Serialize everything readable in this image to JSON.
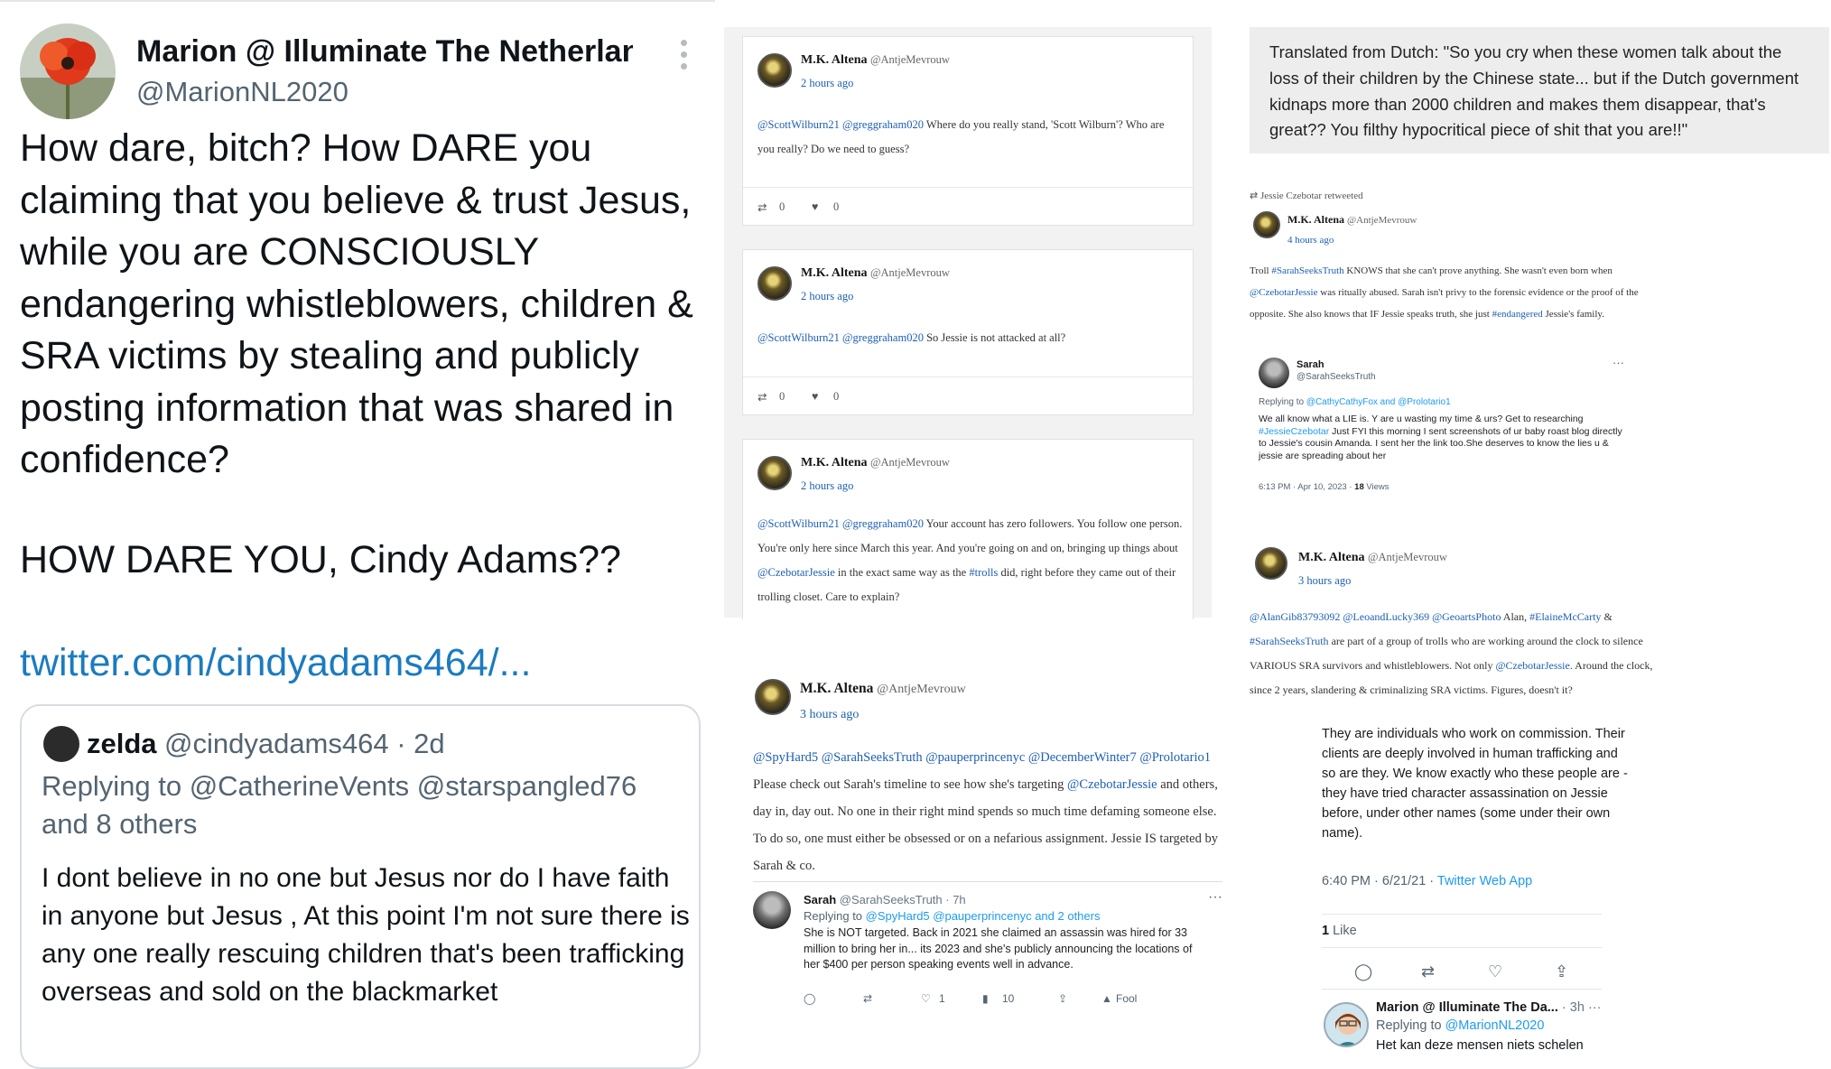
{
  "panel1": {
    "author_name": "Marion @ Illuminate The Netherlan...",
    "author_handle": "@MarionNL2020",
    "body": "How dare, bitch? How DARE you claiming that you believe & trust Jesus, while you are CONSCIOUSLY endangering whistleblowers, children & SRA victims by stealing and publicly posting information that was shared in confidence?",
    "shout": "HOW DARE YOU, Cindy Adams??",
    "link": "twitter.com/cindyadams464/...",
    "quote": {
      "name": "zelda",
      "handle_time": "@cindyadams464 · 2d",
      "replying": "Replying to @CatherineVents @starspangled76 and 8 others",
      "body": "I dont believe in no one but Jesus nor do I have faith in anyone but Jesus , At this point I'm not sure there is any one really rescuing children that's been trafficking overseas and sold on the blackmarket"
    }
  },
  "cards": [
    {
      "name": "M.K. Altena",
      "handle": "@AntjeMevrouw",
      "time": "2 hours ago",
      "mentions": "@ScottWilburn21 @greggraham020",
      "text": " Where do you really stand, 'Scott Wilburn'? Who are you really? Do we need to guess?",
      "retweets": "0",
      "likes": "0"
    },
    {
      "name": "M.K. Altena",
      "handle": "@AntjeMevrouw",
      "time": "2 hours ago",
      "mentions": "@ScottWilburn21 @greggraham020",
      "text": " So Jessie is not attacked at all?",
      "retweets": "0",
      "likes": "0"
    },
    {
      "name": "M.K. Altena",
      "handle": "@AntjeMevrouw",
      "time": "2 hours ago",
      "mentions": "@ScottWilburn21 @greggraham020",
      "text_a": " Your account has zero followers. You follow one person. You're only here since March this year. And you're going on and on, bringing up things about ",
      "tag1": "@CzebotarJessie",
      "text_b": " in the exact same way as the ",
      "tag2": "#trolls",
      "text_c": " did, right before they came out of their trolling closet. Care to explain?"
    }
  ],
  "panel3": {
    "name": "M.K. Altena",
    "handle": "@AntjeMevrouw",
    "time": "3 hours ago",
    "mentions": "@SpyHard5 @SarahSeeksTruth @pauperprincenyc @DecemberWinter7 @Prolotario1",
    "text_a": " Please check out Sarah's timeline to see how she's targeting ",
    "tag": "@CzebotarJessie",
    "text_b": " and others, day in, day out. No one in their right mind spends so much time defaming someone else. To do so, one must either be obsessed or on a nefarious assignment. Jessie IS targeted by Sarah & co.",
    "embed": {
      "name": "Sarah",
      "handle_time": "@SarahSeeksTruth · 7h",
      "replying_prefix": "Replying to ",
      "replying_users": "@SpyHard5 @pauperprincenyc and 2 others",
      "body": "She is NOT targeted. Back in 2021 she claimed an assassin was hired for 33 million to bring her in... its 2023 and she's publicly announcing the locations of her $400 per person speaking events well in advance.",
      "likes": "1",
      "views": "10",
      "translate": "Fool"
    }
  },
  "translation": "Translated from Dutch:  \"So you cry when these women talk about the loss of their children by the Chinese state... but if the Dutch government kidnaps more than 2000 children and makes them disappear, that's great?? You filthy hypocritical piece of shit that you are!!\"",
  "panel4": {
    "retweeted_by": "Jessie Czebotar retweeted",
    "name": "M.K. Altena",
    "handle": "@AntjeMevrouw",
    "time": "4 hours ago",
    "t1": "Troll ",
    "tag1": "#SarahSeeksTruth",
    "t2": " KNOWS that she can't prove anything. She wasn't even born when ",
    "tag2": "@CzebotarJessie",
    "t3": " was ritually abused. Sarah isn't privy to the forensic evidence or the proof of the opposite. She also knows that IF Jessie speaks truth, she just ",
    "tag3": "#endangered",
    "t4": " Jessie's family.",
    "embed": {
      "name": "Sarah",
      "handle": "@SarahSeeksTruth",
      "replying_prefix": "Replying to ",
      "replying_users": "@CathyCathyFox and @Prolotario1",
      "b1": "We all know what a LIE is. Y are u wasting my time & urs? Get to researching ",
      "btag": "#JessieCzebotar",
      "b2": " Just FYI this morning I sent screenshots of ur baby roast blog directly to Jessie's cousin Amanda. I sent her the link too.She deserves to know the lies u & jessie are spreading about her",
      "meta": "6:13 PM · Apr 10, 2023 · ",
      "views": "18",
      "views_label": " Views"
    }
  },
  "panel5": {
    "name": "M.K. Altena",
    "handle": "@AntjeMevrouw",
    "time": "3 hours ago",
    "mentions1": "@AlanGib83793092 @LeoandLucky369 @GeoartsPhoto",
    "t1": " Alan, ",
    "tag1": "#ElaineMcCarty",
    "t2": " & ",
    "tag2": "#SarahSeeksTruth",
    "t3": " are part of a group of trolls who are working around the clock to silence VARIOUS SRA survivors and whistleblowers. Not only ",
    "tag3": "@CzebotarJessie",
    "t4": ". Around the clock, since 2 years, slandering & criminalizing SRA victims. Figures, doesn't it?",
    "quote_body": "They are individuals who work on commission. Their clients are deeply involved in human trafficking and so are they. We know exactly who these people are - they have tried character assassination on Jessie before, under other names (some under their own name).",
    "meta_time": "6:40 PM · 6/21/21 · ",
    "meta_app": "Twitter Web App",
    "likes": "1",
    "likes_label": " Like",
    "reply": {
      "name": "Marion @ Illuminate The Da...",
      "time": "· 3h",
      "replying_prefix": "Replying to ",
      "replying_user": "@MarionNL2020",
      "body": "Het kan deze mensen niets schelen"
    }
  }
}
